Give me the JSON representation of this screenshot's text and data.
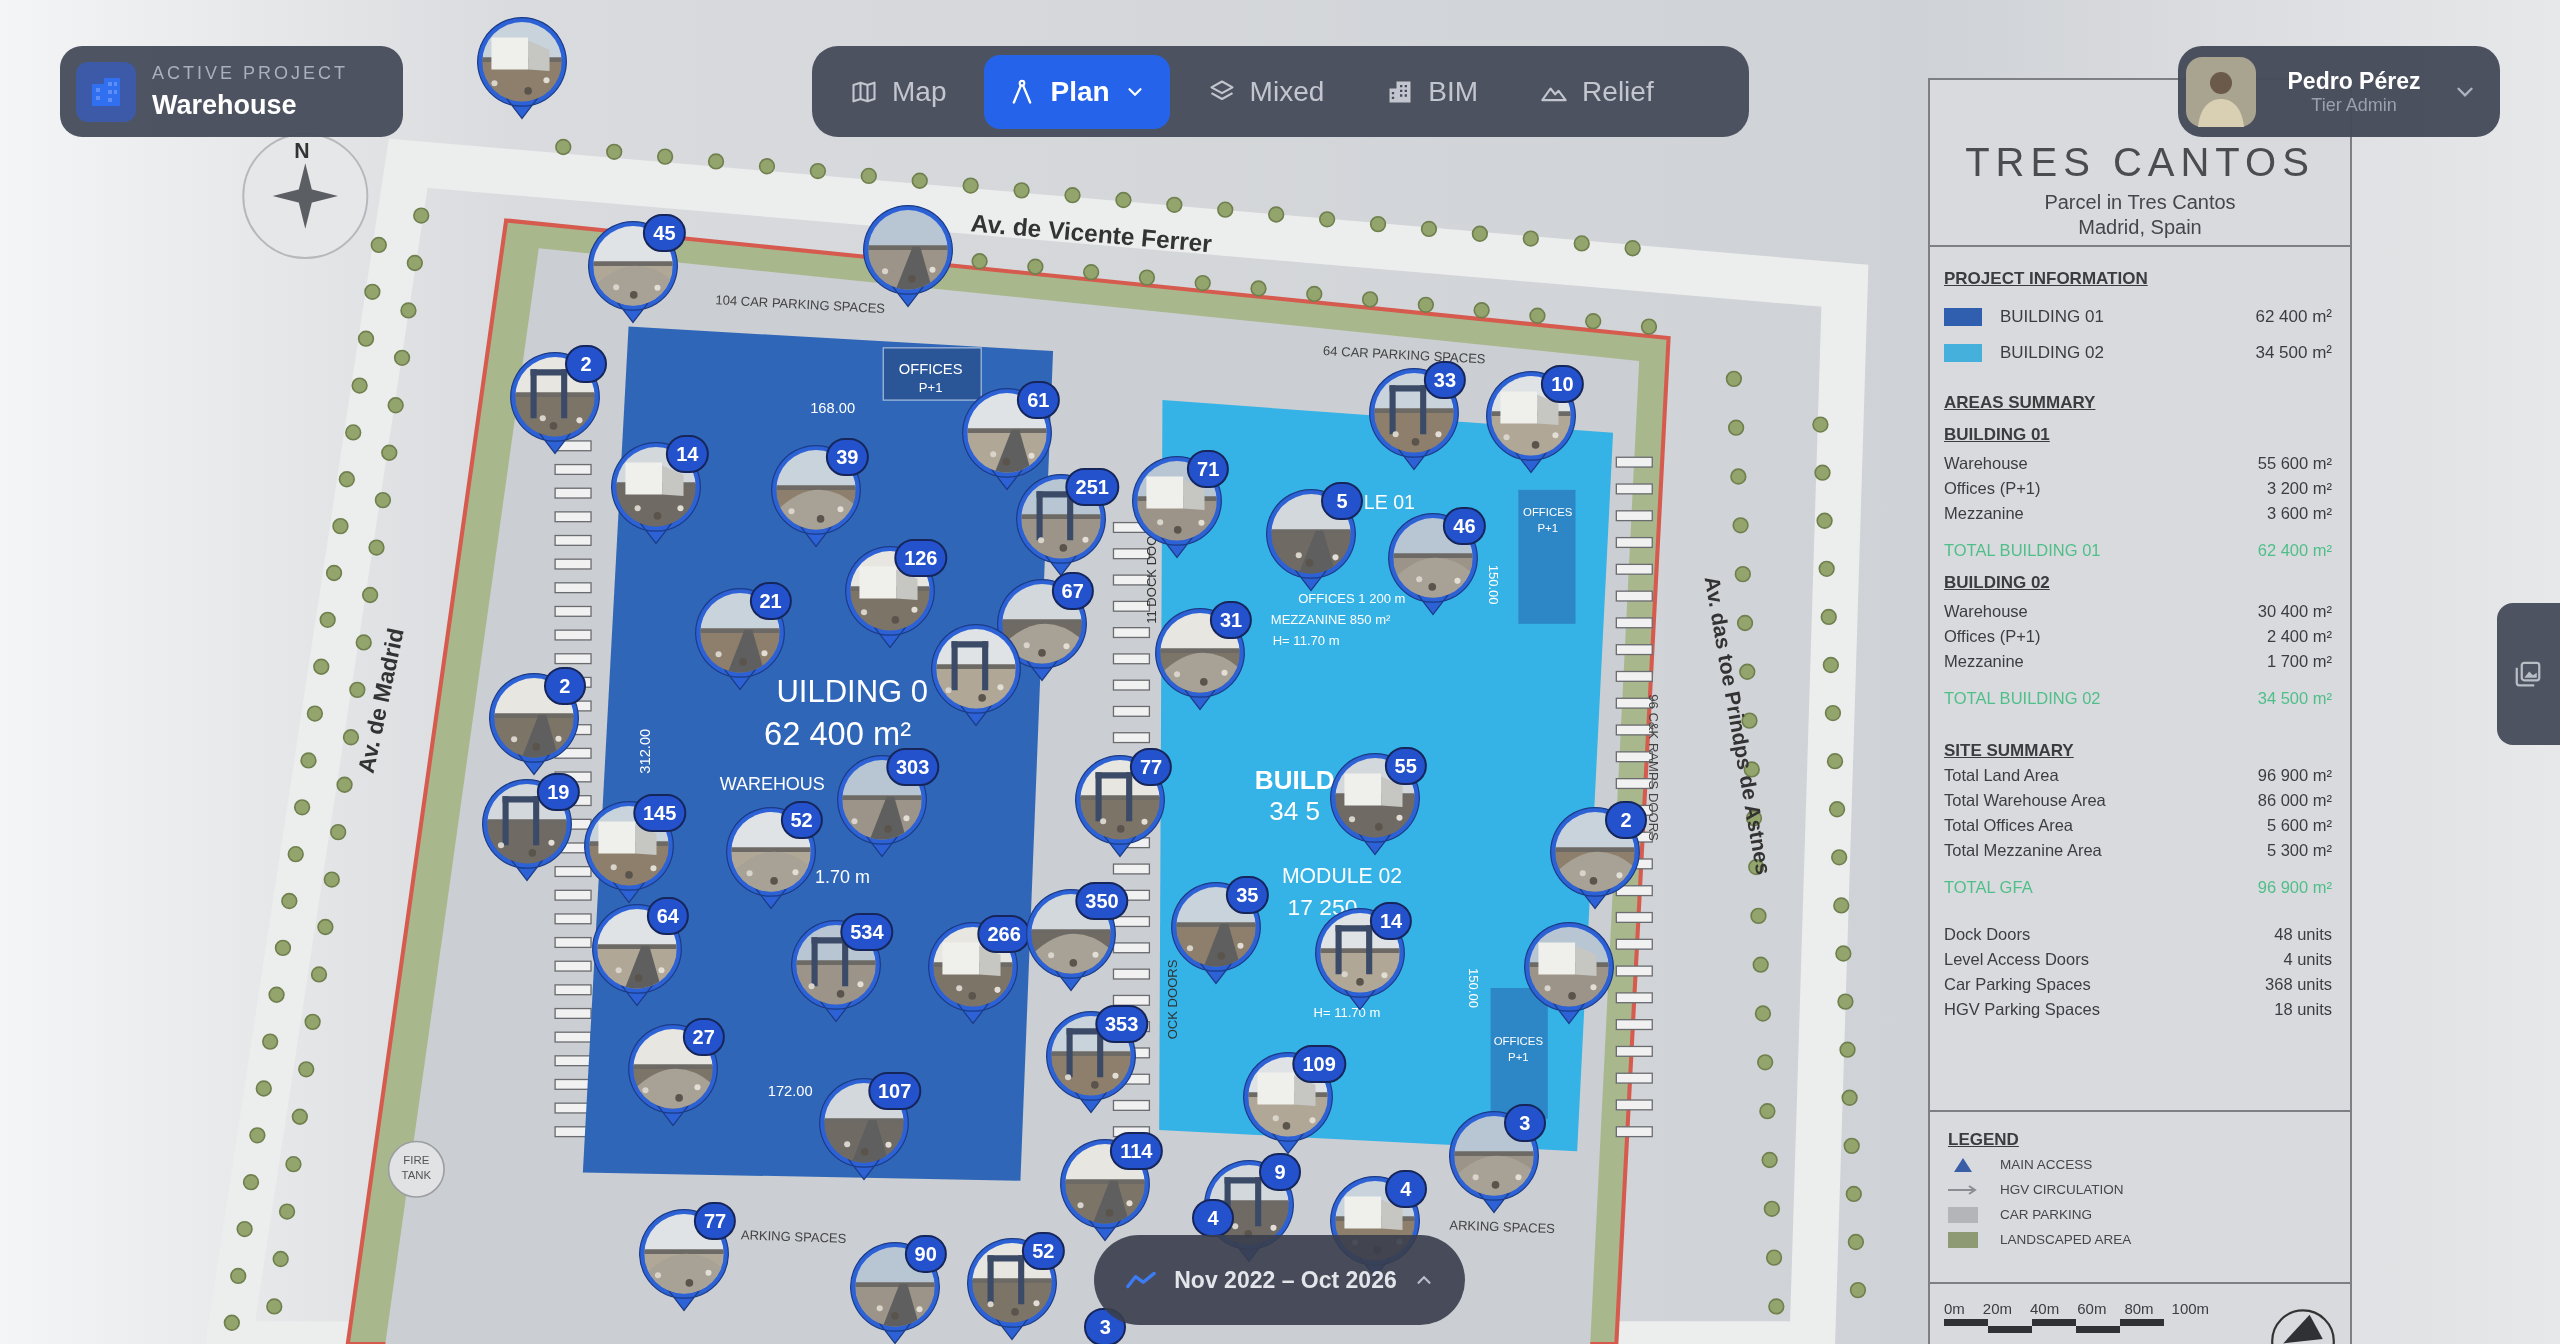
{
  "project": {
    "label": "ACTIVE PROJECT",
    "name": "Warehouse"
  },
  "view_modes": [
    {
      "label": "Map",
      "kind": "map",
      "selected": false
    },
    {
      "label": "Plan",
      "kind": "plan",
      "selected": true
    },
    {
      "label": "Mixed",
      "kind": "mixed",
      "selected": false
    },
    {
      "label": "BIM",
      "kind": "bim",
      "selected": false
    },
    {
      "label": "Relief",
      "kind": "relief",
      "selected": false
    }
  ],
  "user": {
    "name": "Pedro Pérez",
    "role": "Tier Admin"
  },
  "plan": {
    "labels": [
      "N",
      "Av. de Vicente Ferrer",
      "104 CAR PARKING SPACES",
      "64 CAR PARKING SPACES",
      "OFFICES",
      "P+1",
      "168.00",
      "312.00",
      "UILDING 0",
      "62 400 m²",
      "WAREHOUS",
      "1.70 m",
      "172.00",
      "Av. de Madrid",
      "FIRE",
      "TANK",
      "11 DOCK DOO",
      "LE 01",
      "OFFICES 1 200 m",
      "MEZZANINE 850 m²",
      "H= 11.70 m",
      "150.00",
      "OFFICES",
      "P+1",
      "BUILD",
      "34 5",
      "MODULE 02",
      "17 250",
      "H= 11.70 m",
      "150.00",
      "OFFICES",
      "P+1",
      "96 C&K RAMPS DOORS",
      "Av. das toe Prindps de Astnes",
      "ARKING SPACES",
      "ARKING SPACES",
      "OCK DOORS"
    ]
  },
  "photo_pins": [
    {
      "kind": "picture"
    },
    {
      "kind": "picture",
      "count": "45"
    },
    {
      "kind": "picture"
    },
    {
      "kind": "picture",
      "count": "2"
    },
    {
      "kind": "picture",
      "count": "14"
    },
    {
      "kind": "picture",
      "count": "39"
    },
    {
      "kind": "picture",
      "count": "61"
    },
    {
      "kind": "picture",
      "count": "251"
    },
    {
      "kind": "picture",
      "count": "126"
    },
    {
      "kind": "picture",
      "count": "67"
    },
    {
      "kind": "picture",
      "count": "21"
    },
    {
      "kind": "picture"
    },
    {
      "kind": "picture",
      "count": "71"
    },
    {
      "kind": "picture",
      "count": "31"
    },
    {
      "kind": "picture",
      "count": "5"
    },
    {
      "kind": "picture",
      "count": "33"
    },
    {
      "kind": "picture",
      "count": "10"
    },
    {
      "kind": "picture",
      "count": "46"
    },
    {
      "kind": "picture",
      "count": "2"
    },
    {
      "kind": "picture",
      "count": "19"
    },
    {
      "kind": "picture",
      "count": "145"
    },
    {
      "kind": "picture",
      "count": "52"
    },
    {
      "kind": "picture",
      "count": "303"
    },
    {
      "kind": "picture",
      "count": "77"
    },
    {
      "kind": "picture",
      "count": "55"
    },
    {
      "kind": "picture",
      "count": "2"
    },
    {
      "kind": "picture",
      "count": "64"
    },
    {
      "kind": "picture",
      "count": "534"
    },
    {
      "kind": "picture",
      "count": "266"
    },
    {
      "kind": "picture",
      "count": "350"
    },
    {
      "kind": "picture",
      "count": "35"
    },
    {
      "kind": "picture",
      "count": "14"
    },
    {
      "kind": "picture"
    },
    {
      "kind": "picture",
      "count": "27"
    },
    {
      "kind": "picture",
      "count": "107"
    },
    {
      "kind": "picture",
      "count": "353"
    },
    {
      "kind": "picture",
      "count": "109"
    },
    {
      "kind": "picture",
      "count": "3"
    },
    {
      "kind": "picture",
      "count": "114"
    },
    {
      "kind": "picture",
      "count": "9"
    },
    {
      "kind": "picture",
      "count": "4"
    },
    {
      "kind": "picture",
      "count": "77"
    },
    {
      "kind": "picture",
      "count": "90"
    },
    {
      "kind": "picture",
      "count": "52"
    },
    {
      "count": "4"
    },
    {
      "count": "3"
    }
  ],
  "title_block": {
    "title": "TRES CANTOS",
    "subtitle": [
      "Parcel in Tres Cantos",
      "Madrid, Spain"
    ],
    "project_information": {
      "heading": "PROJECT INFORMATION",
      "items": [
        {
          "label": "BUILDING 01",
          "value": "62 400 m²",
          "color": "#2f5fae"
        },
        {
          "label": "BUILDING 02",
          "value": "34 500 m²",
          "color": "#45b0dc"
        }
      ]
    },
    "areas_summary": {
      "heading": "AREAS SUMMARY",
      "buildings": [
        {
          "heading": "BUILDING 01",
          "rows": [
            {
              "label": "Warehouse",
              "value": "55 600 m²"
            },
            {
              "label": "Offices (P+1)",
              "value": "3 200 m²"
            },
            {
              "label": "Mezzanine",
              "value": "3 600 m²"
            }
          ],
          "total": {
            "label": "TOTAL BUILDING 01",
            "value": "62 400 m²"
          }
        },
        {
          "heading": "BUILDING 02",
          "rows": [
            {
              "label": "Warehouse",
              "value": "30 400 m²"
            },
            {
              "label": "Offices (P+1)",
              "value": "2 400 m²"
            },
            {
              "label": "Mezzanine",
              "value": "1 700 m²"
            }
          ],
          "total": {
            "label": "TOTAL BUILDING 02",
            "value": "34 500 m²"
          }
        }
      ]
    },
    "site_summary": {
      "heading": "SITE SUMMARY",
      "rows": [
        {
          "label": "Total Land Area",
          "value": "96 900 m²"
        },
        {
          "label": "Total Warehouse Area",
          "value": "86 000 m²"
        },
        {
          "label": "Total Offices Area",
          "value": "5 600 m²"
        },
        {
          "label": "Total Mezzanine Area",
          "value": "5 300 m²"
        }
      ],
      "total": {
        "label": "TOTAL GFA",
        "value": "96 900 m²"
      }
    },
    "counts": [
      {
        "label": "Dock Doors",
        "value": "48 units"
      },
      {
        "label": "Level Access Doors",
        "value": "4 units"
      },
      {
        "label": "Car Parking Spaces",
        "value": "368 units"
      },
      {
        "label": "HGV Parking Spaces",
        "value": "18 units"
      }
    ],
    "legend": {
      "heading": "LEGEND",
      "items": [
        {
          "kind": "triangle",
          "label": "MAIN ACCESS",
          "color": "#3a5da8"
        },
        {
          "kind": "arrow",
          "label": "HGV CIRCULATION",
          "color": "#8a8d92"
        },
        {
          "kind": "swatch",
          "label": "CAR PARKING",
          "color": "#b4b5b9"
        },
        {
          "kind": "swatch",
          "label": "LANDSCAPED AREA",
          "color": "#8e9a73"
        }
      ]
    },
    "scale_bar": [
      "0m",
      "20m",
      "40m",
      "60m",
      "80m",
      "100m"
    ]
  },
  "timeline": {
    "range": "Nov 2022 – Oct 2026"
  }
}
